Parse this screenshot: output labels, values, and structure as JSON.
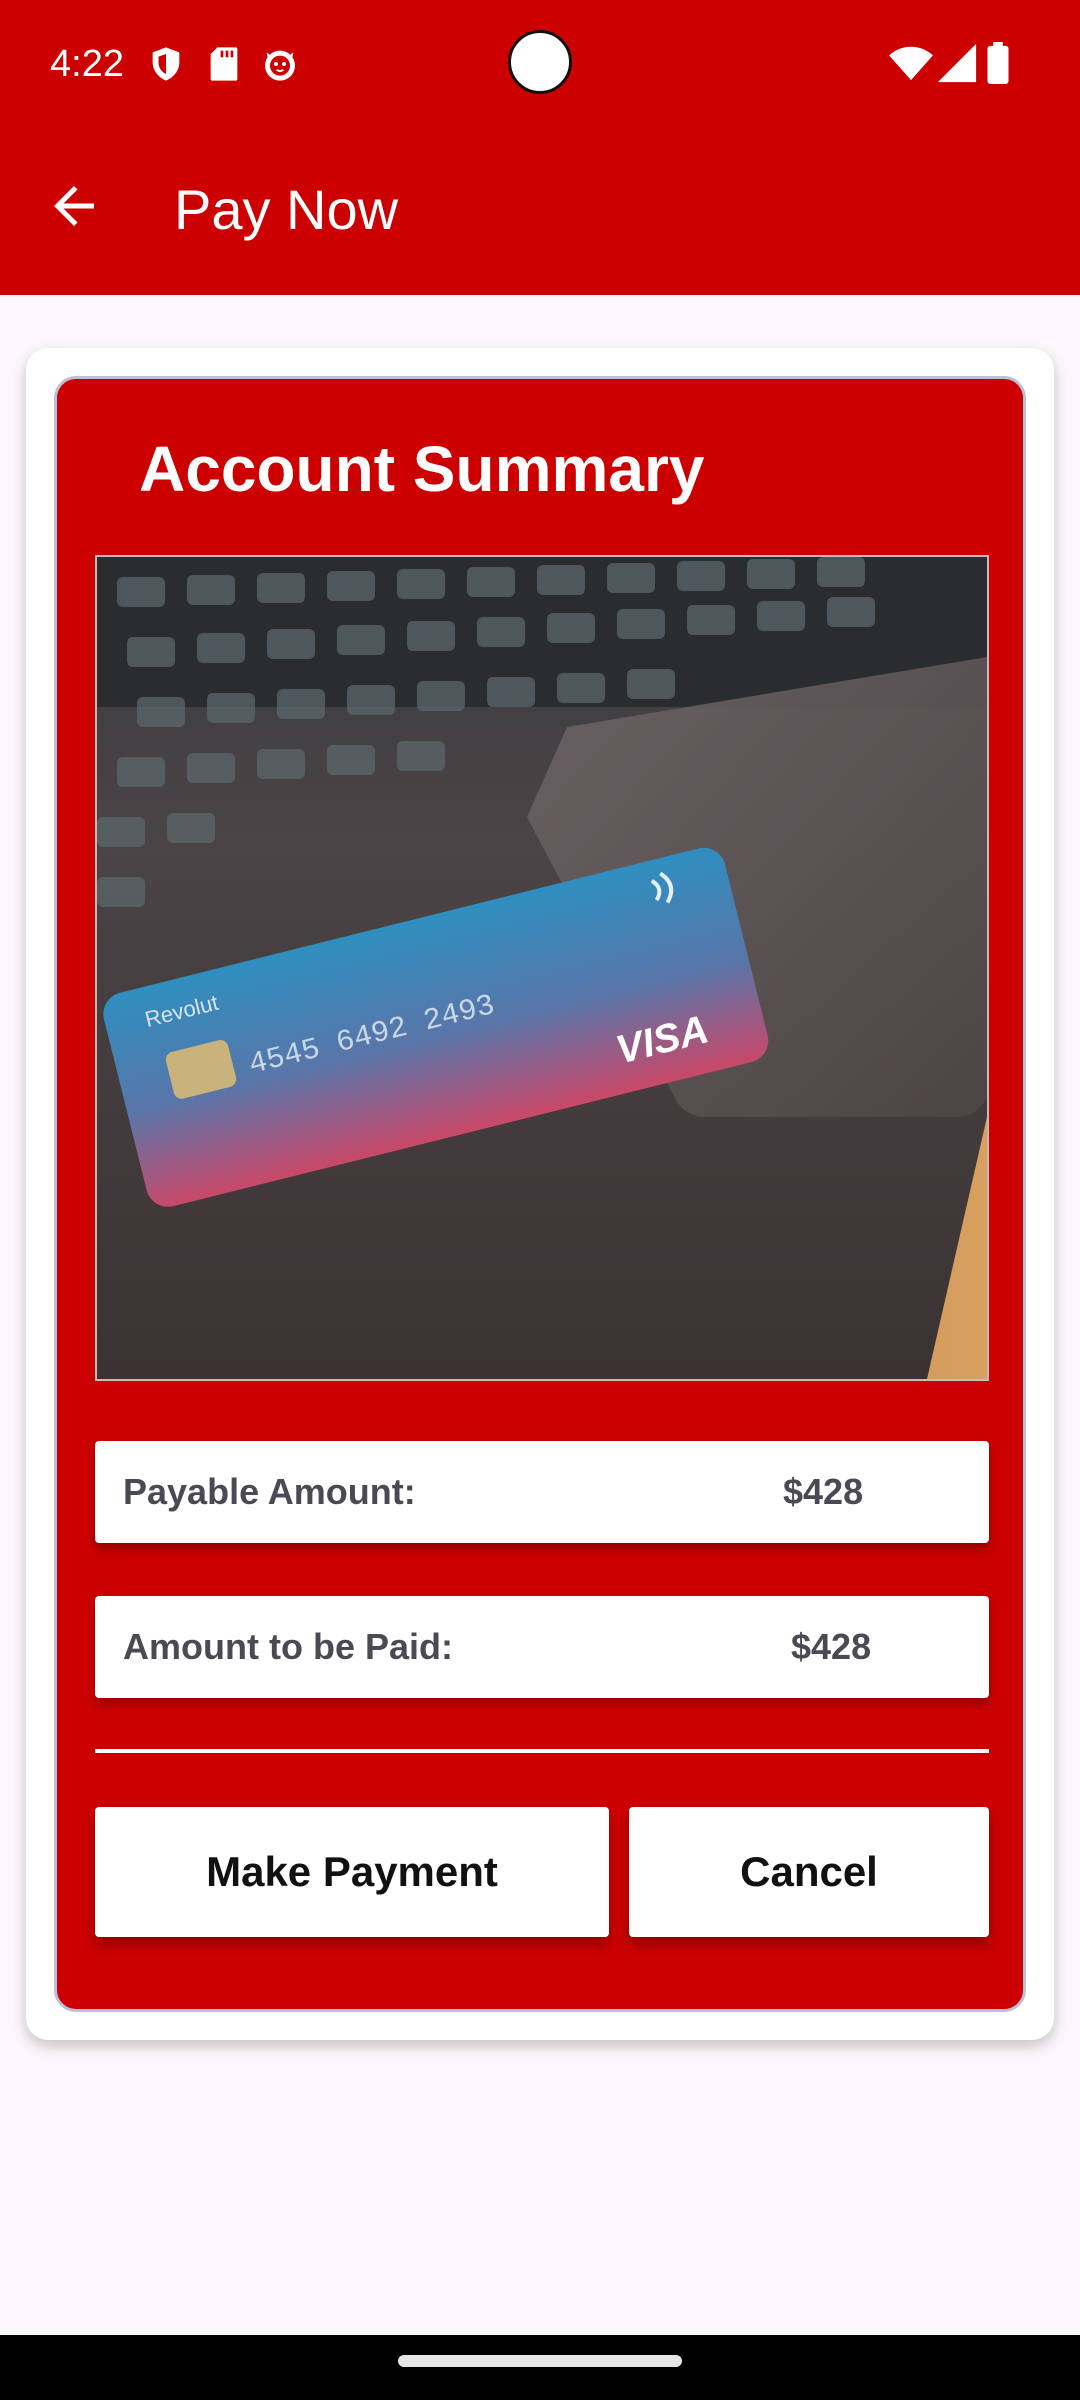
{
  "status_bar": {
    "time": "4:22",
    "left_icons": [
      "shield-icon",
      "sd-card-icon",
      "cat-face-icon"
    ],
    "right_icons": [
      "wifi-icon",
      "cell-signal-icon",
      "battery-icon"
    ]
  },
  "app_bar": {
    "title": "Pay Now",
    "back_icon": "arrow-left-icon"
  },
  "summary": {
    "title": "Account Summary",
    "photo": {
      "brand": "VISA",
      "card_name": "Revolut",
      "card_number": "4545 6492 2493"
    },
    "rows": [
      {
        "label": "Payable Amount:",
        "value": "$428"
      },
      {
        "label": "Amount to be Paid:",
        "value": "$428"
      }
    ],
    "buttons": {
      "make_payment": "Make Payment",
      "cancel": "Cancel"
    }
  },
  "colors": {
    "brand_red": "#cc0000",
    "background": "#fcf7fc",
    "card_white": "#ffffff",
    "text_dark": "#4a4a55"
  }
}
